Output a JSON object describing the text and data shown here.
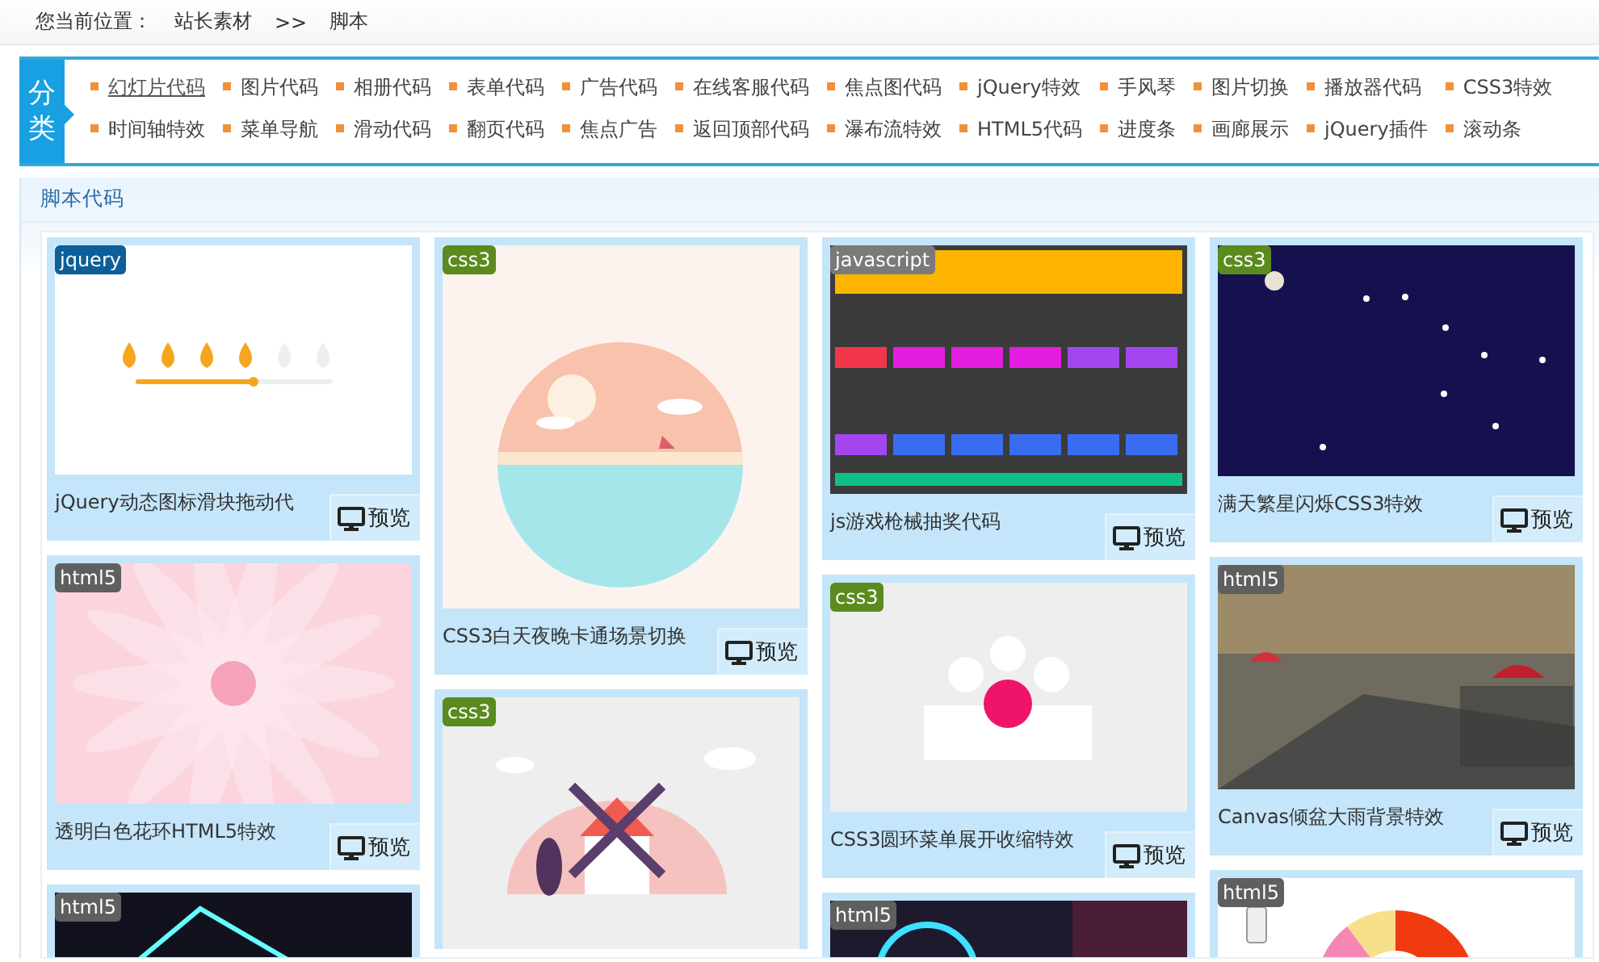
{
  "breadcrumb": {
    "label": "您当前位置：",
    "items": [
      "站长素材",
      "脚本"
    ],
    "separator": ">>"
  },
  "categories": {
    "title": "分类",
    "items": [
      {
        "label": "幻灯片代码",
        "selected": true
      },
      {
        "label": "图片代码",
        "selected": false
      },
      {
        "label": "相册代码",
        "selected": false
      },
      {
        "label": "表单代码",
        "selected": false
      },
      {
        "label": "广告代码",
        "selected": false
      },
      {
        "label": "在线客服代码",
        "selected": false
      },
      {
        "label": "焦点图代码",
        "selected": false
      },
      {
        "label": "jQuery特效",
        "selected": false
      },
      {
        "label": "手风琴",
        "selected": false
      },
      {
        "label": "图片切换",
        "selected": false
      },
      {
        "label": "播放器代码",
        "selected": false
      },
      {
        "label": "CSS3特效",
        "selected": false
      },
      {
        "label": "时间轴特效",
        "selected": false
      },
      {
        "label": "菜单导航",
        "selected": false
      },
      {
        "label": "滑动代码",
        "selected": false
      },
      {
        "label": "翻页代码",
        "selected": false
      },
      {
        "label": "焦点广告",
        "selected": false
      },
      {
        "label": "返回顶部代码",
        "selected": false
      },
      {
        "label": "瀑布流特效",
        "selected": false
      },
      {
        "label": "HTML5代码",
        "selected": false
      },
      {
        "label": "进度条",
        "selected": false
      },
      {
        "label": "画廊展示",
        "selected": false
      },
      {
        "label": "jQuery插件",
        "selected": false
      },
      {
        "label": "滚动条",
        "selected": false
      }
    ]
  },
  "panel": {
    "title": "脚本代码",
    "columns": [
      [
        {
          "tag": "jquery",
          "color": "#0d5e99",
          "title": "jQuery动态图标滑块拖动代",
          "button": "预览"
        },
        {
          "tag": "html5",
          "color": "#5f5f5f",
          "title": "透明白色花环HTML5特效",
          "button": "预览"
        },
        {
          "tag": "html5",
          "color": "#5f5f5f"
        }
      ],
      [
        {
          "tag": "css3",
          "color": "#5b8a1f",
          "title": "CSS3白天夜晚卡通场景切换",
          "button": "预览"
        },
        {
          "tag": "css3",
          "color": "#5b8a1f"
        }
      ],
      [
        {
          "tag": "javascript",
          "color": "#7a7a7a",
          "title": "js游戏枪械抽奖代码",
          "button": "预览"
        },
        {
          "tag": "css3",
          "color": "#5b8a1f",
          "title": "CSS3圆环菜单展开收缩特效",
          "button": "预览"
        },
        {
          "tag": "html5",
          "color": "#5f5f5f"
        }
      ],
      [
        {
          "tag": "css3",
          "color": "#5b8a1f",
          "title": "满天繁星闪烁CSS3特效",
          "button": "预览"
        },
        {
          "tag": "html5",
          "color": "#5f5f5f",
          "title": "Canvas倾盆大雨背景特效",
          "button": "预览"
        },
        {
          "tag": "html5",
          "color": "#5f5f5f"
        }
      ]
    ]
  }
}
